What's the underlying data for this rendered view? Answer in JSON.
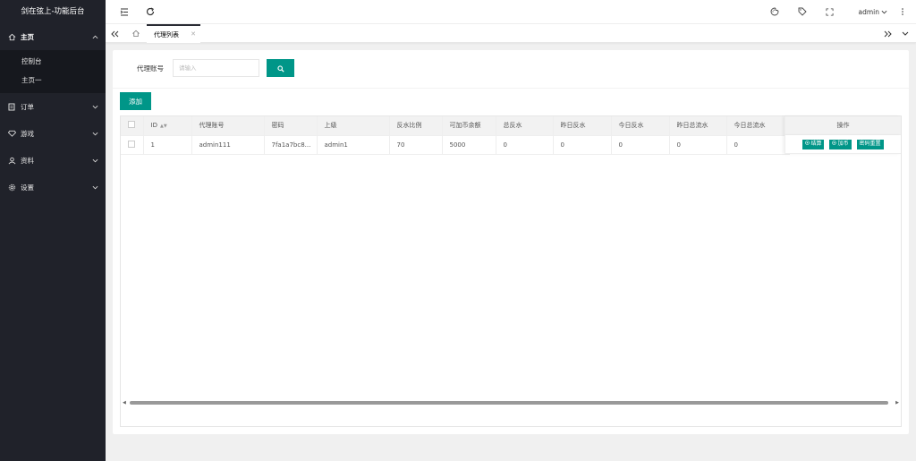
{
  "app": {
    "title": "剑在弦上-功能后台"
  },
  "sidebar": {
    "items": [
      {
        "label": "主页",
        "icon": "home-icon",
        "expanded": true,
        "children": [
          {
            "label": "控制台"
          },
          {
            "label": "主页一"
          }
        ]
      },
      {
        "label": "订单",
        "icon": "order-icon"
      },
      {
        "label": "游戏",
        "icon": "diamond-icon"
      },
      {
        "label": "资料",
        "icon": "user-icon"
      },
      {
        "label": "设置",
        "icon": "gear-icon"
      }
    ]
  },
  "header": {
    "user": "admin"
  },
  "tabs": [
    {
      "label": "代理列表",
      "active": true
    }
  ],
  "search": {
    "label": "代理账号",
    "placeholder": "请输入"
  },
  "toolbar": {
    "add_label": "添加"
  },
  "table": {
    "columns": [
      "ID",
      "代理账号",
      "密码",
      "上级",
      "反水比例",
      "可加币余额",
      "总反水",
      "昨日反水",
      "今日反水",
      "昨日总流水",
      "今日总流水"
    ],
    "ops_header": "操作",
    "rows": [
      {
        "cells": [
          "1",
          "admin111",
          "7fa1a7bc8...",
          "admin1",
          "70",
          "5000",
          "0",
          "0",
          "0",
          "0",
          "0"
        ]
      }
    ],
    "actions": [
      "结算",
      "加币",
      "密码重置"
    ]
  },
  "colors": {
    "accent": "#009688",
    "sidebar": "#20222a"
  }
}
